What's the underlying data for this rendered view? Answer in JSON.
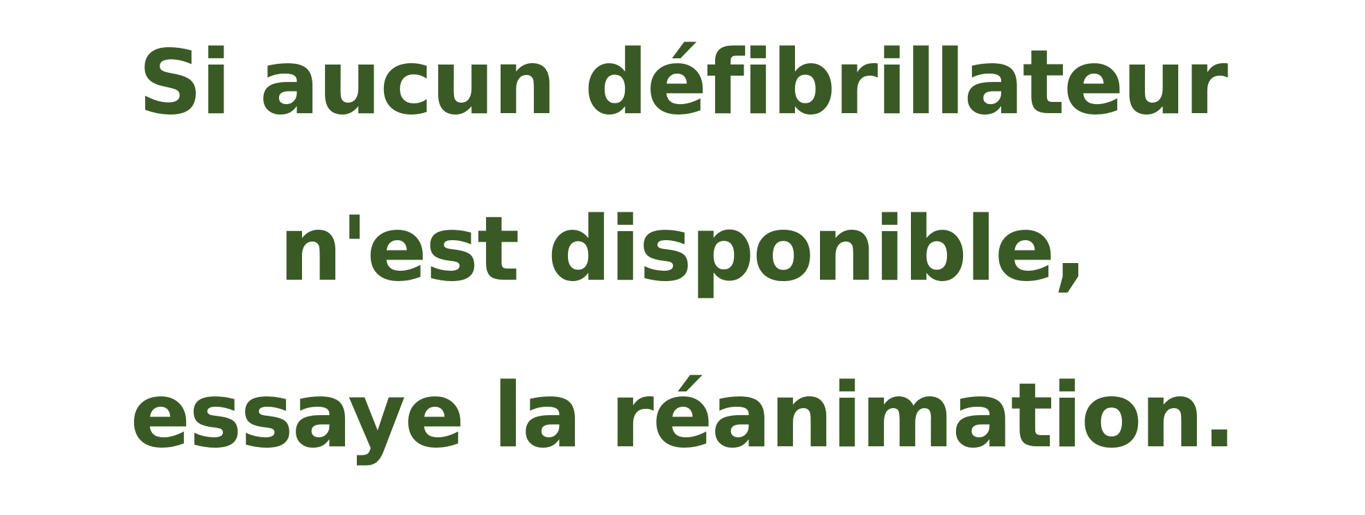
{
  "colors": {
    "text": "#3a5a25",
    "background": "#ffffff"
  },
  "message": {
    "line1": "Si aucun défibrillateur",
    "line2": "n'est disponible,",
    "line3": "essaye la réanimation."
  }
}
